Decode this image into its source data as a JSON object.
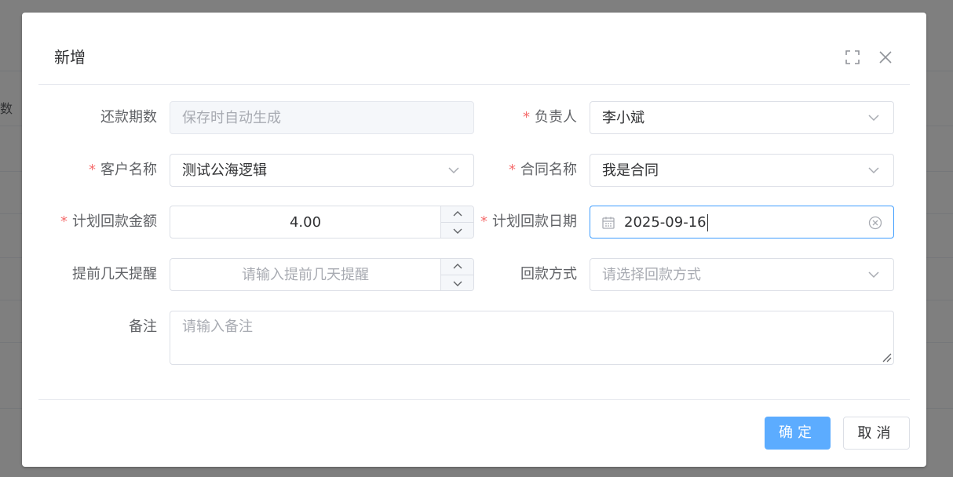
{
  "background": {
    "fragment_left": "数"
  },
  "dialog": {
    "title": "新增",
    "maximize_icon": "fullscreen-icon",
    "close_icon": "close-icon"
  },
  "form": {
    "required_mark": "*",
    "period": {
      "label": "还款期数",
      "placeholder": "保存时自动生成"
    },
    "owner": {
      "label": "负责人",
      "value": "李小斌"
    },
    "customer": {
      "label": "客户名称",
      "value": "测试公海逻辑"
    },
    "contract": {
      "label": "合同名称",
      "value": "我是合同"
    },
    "amount": {
      "label": "计划回款金额",
      "value": "4.00"
    },
    "date": {
      "label": "计划回款日期",
      "value": "2025-09-16"
    },
    "remind": {
      "label": "提前几天提醒",
      "placeholder": "请输入提前几天提醒"
    },
    "method": {
      "label": "回款方式",
      "placeholder": "请选择回款方式"
    },
    "remark": {
      "label": "备注",
      "placeholder": "请输入备注"
    }
  },
  "footer": {
    "confirm_label": "确定",
    "cancel_label": "取消"
  },
  "colors": {
    "primary": "#409eff",
    "required": "#f56c6c",
    "border": "#dcdfe6"
  }
}
